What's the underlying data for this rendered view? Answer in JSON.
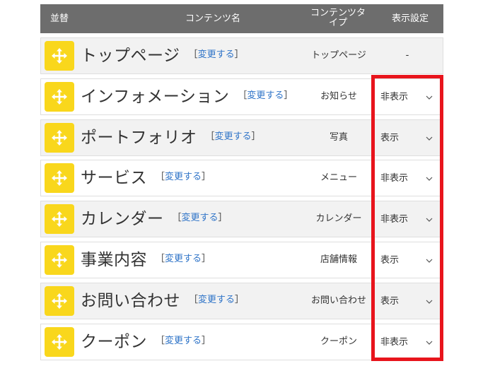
{
  "header": {
    "sort": "並替",
    "name": "コンテンツ名",
    "type_line1": "コンテンツタ",
    "type_line2": "イプ",
    "display": "表示設定"
  },
  "change_open": "［",
  "change_label": "変更する",
  "change_close": "］",
  "rows": [
    {
      "name": "トップページ",
      "type": "トップページ",
      "display": "-",
      "has_select": false
    },
    {
      "name": "インフォメーション",
      "type": "お知らせ",
      "display": "非表示",
      "has_select": true
    },
    {
      "name": "ポートフォリオ",
      "type": "写真",
      "display": "表示",
      "has_select": true
    },
    {
      "name": "サービス",
      "type": "メニュー",
      "display": "非表示",
      "has_select": true
    },
    {
      "name": "カレンダー",
      "type": "カレンダー",
      "display": "非表示",
      "has_select": true
    },
    {
      "name": "事業内容",
      "type": "店舗情報",
      "display": "表示",
      "has_select": true
    },
    {
      "name": "お問い合わせ",
      "type": "お問い合わせ",
      "display": "表示",
      "has_select": true
    },
    {
      "name": "クーポン",
      "type": "クーポン",
      "display": "非表示",
      "has_select": true
    }
  ],
  "colors": {
    "header_bg": "#6d6d6d",
    "handle_bg": "#f9d71c",
    "link": "#2f74c8",
    "highlight": "#e8141c"
  },
  "icons": {
    "handle": "move-arrows-icon",
    "select": "chevron-down-icon"
  }
}
